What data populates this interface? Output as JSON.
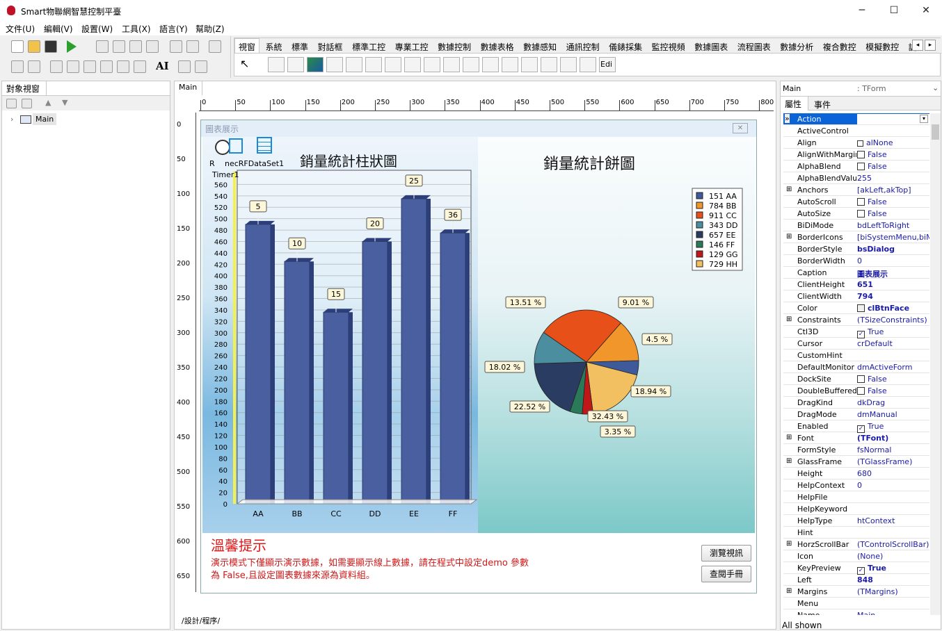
{
  "window": {
    "title": "Smart物聯網智慧控制平臺",
    "minimize": "─",
    "maximize": "☐",
    "close": "✕"
  },
  "menu": [
    "文件(U)",
    "編輯(V)",
    "設置(W)",
    "工具(X)",
    "語言(Y)",
    "幫助(Z)"
  ],
  "palette_tabs": [
    "視窗",
    "系統",
    "標準",
    "對話框",
    "標準工控",
    "專業工控",
    "數據控制",
    "數據表格",
    "數據感知",
    "通訊控制",
    "儀錶採集",
    "監控視頻",
    "數據圖表",
    "流程圖表",
    "數據分析",
    "複合數控",
    "模擬數控",
    "調"
  ],
  "palette_edit_label": "Edi",
  "objview": {
    "tab": "對象視窗",
    "tree_item": "Main"
  },
  "designer": {
    "tab": "Main",
    "bottom_tabs": [
      "設計",
      "程序"
    ]
  },
  "ruler": {
    "h": [
      "0",
      "50",
      "100",
      "150",
      "200",
      "250",
      "300",
      "350",
      "400",
      "450",
      "500",
      "550",
      "600",
      "650",
      "700",
      "750",
      "800"
    ],
    "v": [
      "0",
      "50",
      "100",
      "150",
      "200",
      "250",
      "300",
      "350",
      "400",
      "450",
      "500",
      "550",
      "600",
      "650"
    ]
  },
  "form": {
    "caption": "圖表展示",
    "components": [
      "R",
      "necRFDataSet1",
      "Timer1"
    ],
    "notice_title": "溫馨提示",
    "notice_line1": "演示模式下僅顯示演示數據，如需要顯示線上數據，請在程式中設定demo 參數",
    "notice_line2": "為 False,且設定圖表數據來源為資料組。",
    "btn_browse": "瀏覽視訊",
    "btn_manual": "查閱手冊"
  },
  "chart_data": [
    {
      "type": "bar",
      "title": "銷量統計柱狀圖",
      "categories": [
        "AA",
        "BB",
        "CC",
        "DD",
        "EE",
        "FF"
      ],
      "values": [
        490,
        425,
        336,
        460,
        535,
        475
      ],
      "labels": [
        "5",
        "10",
        "15",
        "20",
        "25",
        "36"
      ],
      "ylim": [
        0,
        580
      ],
      "yticks": [
        0,
        20,
        40,
        60,
        80,
        100,
        120,
        140,
        160,
        180,
        200,
        220,
        240,
        260,
        280,
        300,
        320,
        340,
        360,
        380,
        400,
        420,
        440,
        460,
        480,
        500,
        520,
        540,
        560
      ],
      "color": "#4a5fa0",
      "grid": true
    },
    {
      "type": "pie",
      "title": "銷量統計餅圖",
      "legend": [
        {
          "value": "151",
          "name": "AA",
          "color": "#3f5a9a"
        },
        {
          "value": "784",
          "name": "BB",
          "color": "#f0962a"
        },
        {
          "value": "911",
          "name": "CC",
          "color": "#e8501a"
        },
        {
          "value": "343",
          "name": "DD",
          "color": "#4a8ea0"
        },
        {
          "value": "657",
          "name": "EE",
          "color": "#2b3c62"
        },
        {
          "value": "146",
          "name": "FF",
          "color": "#2a7a5a"
        },
        {
          "value": "129",
          "name": "GG",
          "color": "#c01818"
        },
        {
          "value": "729",
          "name": "HH",
          "color": "#f2c060"
        }
      ],
      "slices": [
        {
          "label": "4.5 %",
          "value": 4.5,
          "color": "#3f5a9a"
        },
        {
          "label": "18.94 %",
          "value": 18.94,
          "color": "#f2c060"
        },
        {
          "label": "3.35 %",
          "value": 3.35,
          "color": "#c01818"
        },
        {
          "label": "32.43 %",
          "value": 3.84,
          "color": "#2a7a5a"
        },
        {
          "label": "22.52 %",
          "value": 19.37,
          "color": "#2b3c62"
        },
        {
          "label": "18.02 %",
          "value": 10.11,
          "color": "#4a8ea0"
        },
        {
          "label": "13.51 %",
          "value": 26.85,
          "color": "#e8501a"
        },
        {
          "label": "9.01 %",
          "value": 13.04,
          "color": "#f0962a"
        }
      ],
      "legend_position": "top-right"
    }
  ],
  "props": {
    "header_name": "Main",
    "header_type": ": TForm",
    "tabs": [
      "屬性",
      "事件"
    ],
    "footer": "All shown",
    "rows": [
      {
        "name": "Action",
        "value": "",
        "bold": false,
        "expand": false
      },
      {
        "name": "ActiveControl",
        "value": "",
        "bold": false,
        "expand": false
      },
      {
        "name": "Align",
        "value": "alNone",
        "bold": false,
        "expand": false
      },
      {
        "name": "AlignWithMargins",
        "value": "False",
        "bold": false,
        "expand": false,
        "check": false
      },
      {
        "name": "AlphaBlend",
        "value": "False",
        "bold": false,
        "expand": false,
        "check": false
      },
      {
        "name": "AlphaBlendValue",
        "value": "255",
        "bold": false,
        "expand": false
      },
      {
        "name": "Anchors",
        "value": "[akLeft,akTop]",
        "bold": false,
        "expand": true
      },
      {
        "name": "AutoScroll",
        "value": "False",
        "bold": false,
        "expand": false,
        "check": false
      },
      {
        "name": "AutoSize",
        "value": "False",
        "bold": false,
        "expand": false,
        "check": false
      },
      {
        "name": "BiDiMode",
        "value": "bdLeftToRight",
        "bold": false,
        "expand": false
      },
      {
        "name": "BorderIcons",
        "value": "[biSystemMenu,biMini",
        "bold": false,
        "expand": true
      },
      {
        "name": "BorderStyle",
        "value": "bsDialog",
        "bold": true,
        "expand": false
      },
      {
        "name": "BorderWidth",
        "value": "0",
        "bold": false,
        "expand": false
      },
      {
        "name": "Caption",
        "value": "圖表展示",
        "bold": true,
        "expand": false
      },
      {
        "name": "ClientHeight",
        "value": "651",
        "bold": true,
        "expand": false
      },
      {
        "name": "ClientWidth",
        "value": "794",
        "bold": true,
        "expand": false
      },
      {
        "name": "Color",
        "value": "clBtnFace",
        "bold": true,
        "expand": false
      },
      {
        "name": "Constraints",
        "value": "(TSizeConstraints)",
        "bold": false,
        "expand": true
      },
      {
        "name": "Ctl3D",
        "value": "True",
        "bold": false,
        "expand": false,
        "check": true
      },
      {
        "name": "Cursor",
        "value": "crDefault",
        "bold": false,
        "expand": false
      },
      {
        "name": "CustomHint",
        "value": "",
        "bold": false,
        "expand": false
      },
      {
        "name": "DefaultMonitor",
        "value": "dmActiveForm",
        "bold": false,
        "expand": false
      },
      {
        "name": "DockSite",
        "value": "False",
        "bold": false,
        "expand": false,
        "check": false
      },
      {
        "name": "DoubleBuffered",
        "value": "False",
        "bold": false,
        "expand": false,
        "check": false
      },
      {
        "name": "DragKind",
        "value": "dkDrag",
        "bold": false,
        "expand": false
      },
      {
        "name": "DragMode",
        "value": "dmManual",
        "bold": false,
        "expand": false
      },
      {
        "name": "Enabled",
        "value": "True",
        "bold": false,
        "expand": false,
        "check": true
      },
      {
        "name": "Font",
        "value": "(TFont)",
        "bold": true,
        "expand": true
      },
      {
        "name": "FormStyle",
        "value": "fsNormal",
        "bold": false,
        "expand": false
      },
      {
        "name": "GlassFrame",
        "value": "(TGlassFrame)",
        "bold": false,
        "expand": true
      },
      {
        "name": "Height",
        "value": "680",
        "bold": false,
        "expand": false
      },
      {
        "name": "HelpContext",
        "value": "0",
        "bold": false,
        "expand": false
      },
      {
        "name": "HelpFile",
        "value": "",
        "bold": false,
        "expand": false
      },
      {
        "name": "HelpKeyword",
        "value": "",
        "bold": false,
        "expand": false
      },
      {
        "name": "HelpType",
        "value": "htContext",
        "bold": false,
        "expand": false
      },
      {
        "name": "Hint",
        "value": "",
        "bold": false,
        "expand": false
      },
      {
        "name": "HorzScrollBar",
        "value": "(TControlScrollBar)",
        "bold": false,
        "expand": true
      },
      {
        "name": "Icon",
        "value": "(None)",
        "bold": false,
        "expand": false
      },
      {
        "name": "KeyPreview",
        "value": "True",
        "bold": true,
        "expand": false,
        "check": true
      },
      {
        "name": "Left",
        "value": "848",
        "bold": true,
        "expand": false
      },
      {
        "name": "Margins",
        "value": "(TMargins)",
        "bold": false,
        "expand": true
      },
      {
        "name": "Menu",
        "value": "",
        "bold": false,
        "expand": false
      },
      {
        "name": "Name",
        "value": "Main",
        "bold": false,
        "expand": false
      }
    ]
  }
}
